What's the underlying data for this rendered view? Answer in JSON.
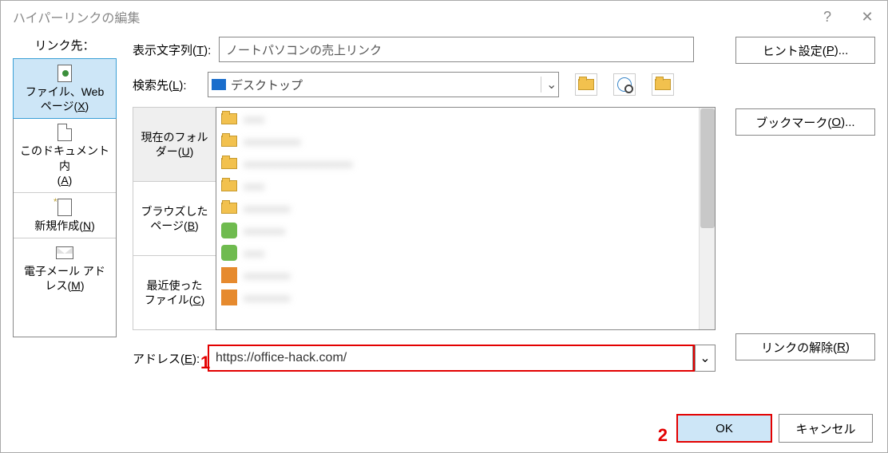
{
  "title": "ハイパーリンクの編集",
  "titlebar": {
    "help": "?",
    "close": "✕"
  },
  "linkto_label": "リンク先：",
  "sidebar": {
    "items": [
      {
        "label1": "ファイル、Web",
        "label2": "ページ(X)"
      },
      {
        "label1": "このドキュメント内",
        "label2": "(A)"
      },
      {
        "label1": "新規作成(N)"
      },
      {
        "label1": "電子メール アド",
        "label2": "レス(M)"
      }
    ]
  },
  "display_text": {
    "label": "表示文字列(T):",
    "value": "ノートパソコンの売上リンク"
  },
  "lookin": {
    "label": "検索先(L):",
    "value": "デスクトップ"
  },
  "browse_tabs": {
    "current": {
      "line1": "現在のフォル",
      "line2": "ダー(U)"
    },
    "browsed": {
      "line1": "ブラウズした",
      "line2": "ページ(B)"
    },
    "recent": {
      "line1": "最近使った",
      "line2": "ファイル(C)"
    }
  },
  "file_list": [
    {
      "type": "folder",
      "text": "xxxx"
    },
    {
      "type": "folder",
      "text": "xxxxxxxxxxx"
    },
    {
      "type": "folder",
      "text": "xxxxxxxxxxxxxxxxxxxxx"
    },
    {
      "type": "folder",
      "text": "xxxx"
    },
    {
      "type": "folder",
      "text": "xxxxxxxxx"
    },
    {
      "type": "green",
      "text": "xxxxxxxx"
    },
    {
      "type": "green",
      "text": "xxxx"
    },
    {
      "type": "orange",
      "text": "xxxxxxxxx"
    },
    {
      "type": "orange",
      "text": "xxxxxxxxx"
    }
  ],
  "address": {
    "label": "アドレス(E):",
    "value": "https://office-hack.com/"
  },
  "right": {
    "hint": "ヒント設定(P)...",
    "bookmark": "ブックマーク(O)...",
    "remove": "リンクの解除(R)"
  },
  "footer": {
    "ok": "OK",
    "cancel": "キャンセル"
  },
  "markers": {
    "one": "1",
    "two": "2"
  }
}
